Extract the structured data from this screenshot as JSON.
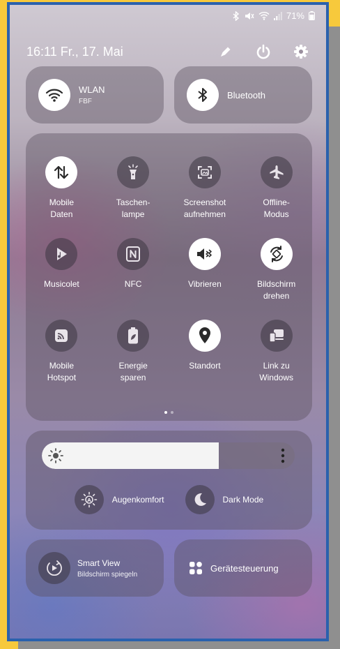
{
  "status_bar": {
    "battery": "71%"
  },
  "header": {
    "time": "16:11",
    "date": "Fr., 17. Mai"
  },
  "connectivity": {
    "wlan": {
      "label": "WLAN",
      "sub": "FBF",
      "active": true
    },
    "bluetooth": {
      "label": "Bluetooth",
      "active": true
    }
  },
  "tiles": [
    {
      "label": "Mobile\nDaten",
      "icon": "mobile-data-icon",
      "active": true
    },
    {
      "label": "Taschen-\nlampe",
      "icon": "flashlight-icon",
      "active": false
    },
    {
      "label": "Screenshot\naufnehmen",
      "icon": "screenshot-icon",
      "active": false
    },
    {
      "label": "Offline-\nModus",
      "icon": "airplane-icon",
      "active": false
    },
    {
      "label": "Musicolet",
      "icon": "musicolet-icon",
      "active": false
    },
    {
      "label": "NFC",
      "icon": "nfc-icon",
      "active": false
    },
    {
      "label": "Vibrieren",
      "icon": "vibrate-icon",
      "active": true
    },
    {
      "label": "Bildschirm\ndrehen",
      "icon": "rotate-icon",
      "active": true
    },
    {
      "label": "Mobile\nHotspot",
      "icon": "hotspot-icon",
      "active": false
    },
    {
      "label": "Energie\nsparen",
      "icon": "battery-saver-icon",
      "active": false
    },
    {
      "label": "Standort",
      "icon": "location-icon",
      "active": true
    },
    {
      "label": "Link zu\nWindows",
      "icon": "link-windows-icon",
      "active": false
    }
  ],
  "pager": {
    "pages": 2,
    "current": 1
  },
  "brightness": {
    "level": 0.7
  },
  "toggles": {
    "eye_comfort": "Augenkomfort",
    "dark_mode": "Dark Mode"
  },
  "bottom": {
    "smart_view": {
      "label": "Smart View",
      "sub": "Bildschirm spiegeln"
    },
    "device_control": {
      "label": "Gerätesteuerung"
    }
  },
  "colors": {
    "frame_border": "#2a61ad",
    "outer_background": "#f7c93c",
    "active_icon_bg": "#ffffff"
  }
}
